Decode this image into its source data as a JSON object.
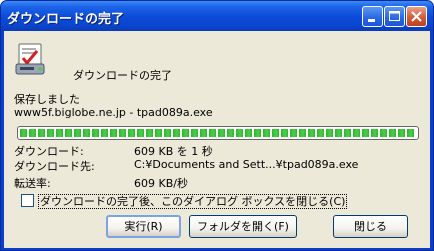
{
  "window": {
    "title": "ダウンロードの完了",
    "controls": {
      "minimize_icon": "minimize-icon",
      "maximize_icon": "maximize-icon",
      "close_icon": "close-icon"
    }
  },
  "header": {
    "icon": "download-complete-icon",
    "heading": "ダウンロードの完了"
  },
  "status": {
    "saved_text": "保存しました",
    "file_line": "www5f.biglobe.ne.jp - tpad089a.exe"
  },
  "progress": {
    "percent": 100
  },
  "details": {
    "download_label": "ダウンロード:",
    "download_value": "609 KB を 1 秒",
    "destination_label": "ダウンロード先:",
    "destination_value": "C:¥Documents and Sett...¥tpad089a.exe",
    "rate_label": "転送率:",
    "rate_value": "609 KB/秒"
  },
  "close_on_complete": {
    "label": "ダウンロードの完了後、このダイアログ ボックスを閉じる(C)",
    "checked": false
  },
  "buttons": {
    "run": "実行(R)",
    "open_folder": "フォルダを開く(F)",
    "close": "閉じる"
  }
}
